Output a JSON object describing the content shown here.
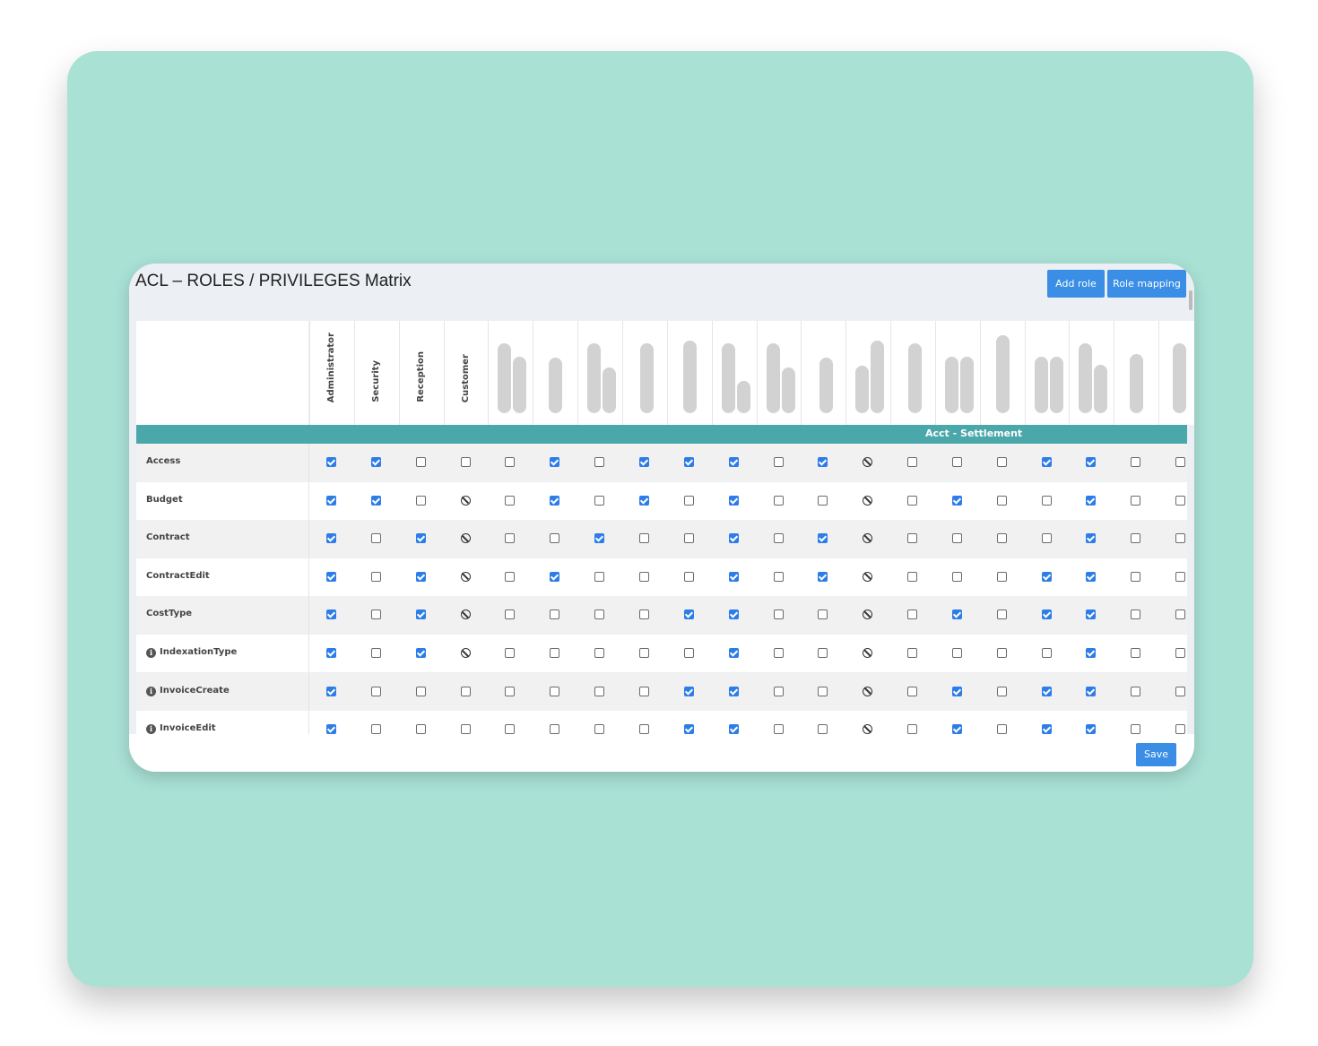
{
  "title": "ACL – ROLES / PRIVILEGES Matrix",
  "toolbar": {
    "add_role": "Add role",
    "role_mapping": "Role mapping"
  },
  "footer": {
    "save": "Save"
  },
  "roles": [
    "Administrator",
    "Security",
    "Reception",
    "Customer"
  ],
  "group_label": "Acct - Settlement",
  "colors": {
    "accent": "#3a8ee6",
    "group_band": "#4aa7aa",
    "background": "#a9e1d5",
    "checkbox_checked": "#2d7de8"
  },
  "rows": [
    {
      "label": "Access",
      "info": false,
      "cells": "CCUUUCUCCCUCBUUUCCUU"
    },
    {
      "label": "Budget",
      "info": false,
      "cells": "CCUBUCUCUCUUBUCUUCUU"
    },
    {
      "label": "Contract",
      "info": false,
      "cells": "CUCBUUCUUCUCBUUUUCUU"
    },
    {
      "label": "ContractEdit",
      "info": false,
      "cells": "CUCBUCUUUCUCBUUUCCUU"
    },
    {
      "label": "CostType",
      "info": false,
      "cells": "CUCBUUUUCCUUBUCUCCUU"
    },
    {
      "label": "IndexationType",
      "info": true,
      "cells": "CUCBUUUUUCUUBUUUUCUU"
    },
    {
      "label": "InvoiceCreate",
      "info": true,
      "cells": "CUUUUUUUCCUUBUCUCCUU"
    },
    {
      "label": "InvoiceEdit",
      "info": true,
      "cells": "CUUUUUUUCCUUBUCUCCUU"
    }
  ]
}
